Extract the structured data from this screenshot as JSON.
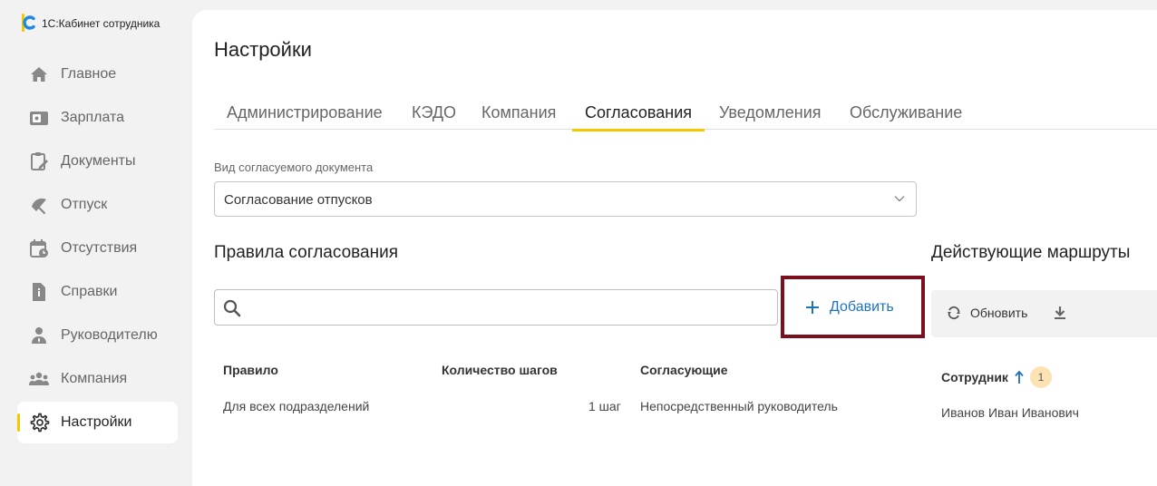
{
  "app": {
    "name": "1С:Кабинет сотрудника",
    "accent_color": "#f5c800"
  },
  "sidebar": {
    "items": [
      {
        "label": "Главное",
        "icon": "home-icon"
      },
      {
        "label": "Зарплата",
        "icon": "wallet-icon"
      },
      {
        "label": "Документы",
        "icon": "clipboard-icon"
      },
      {
        "label": "Отпуск",
        "icon": "umbrella-icon"
      },
      {
        "label": "Отсутствия",
        "icon": "calendar-icon"
      },
      {
        "label": "Справки",
        "icon": "document-info-icon"
      },
      {
        "label": "Руководителю",
        "icon": "manager-icon"
      },
      {
        "label": "Компания",
        "icon": "people-icon"
      },
      {
        "label": "Настройки",
        "icon": "gear-icon",
        "active": true
      }
    ]
  },
  "page": {
    "title": "Настройки"
  },
  "tabs": [
    {
      "label": "Администрирование"
    },
    {
      "label": "КЭДО"
    },
    {
      "label": "Компания"
    },
    {
      "label": "Согласования",
      "active": true
    },
    {
      "label": "Уведомления"
    },
    {
      "label": "Обслуживание"
    }
  ],
  "doc_type": {
    "label": "Вид согласуемого документа",
    "value": "Согласование отпусков"
  },
  "rules": {
    "title": "Правила согласования",
    "search_placeholder": "",
    "add_label": "Добавить",
    "highlight_color": "#7b0f1e",
    "columns": [
      "Правило",
      "Количество шагов",
      "Согласующие"
    ],
    "rows": [
      {
        "rule": "Для всех подразделений",
        "steps": "1 шаг",
        "approvers": "Непосредственный руководитель"
      }
    ]
  },
  "routes": {
    "title": "Действующие маршруты",
    "refresh_label": "Обновить",
    "column": "Сотрудник",
    "badge": "1",
    "rows": [
      {
        "employee": "Иванов Иван Иванович"
      }
    ]
  }
}
